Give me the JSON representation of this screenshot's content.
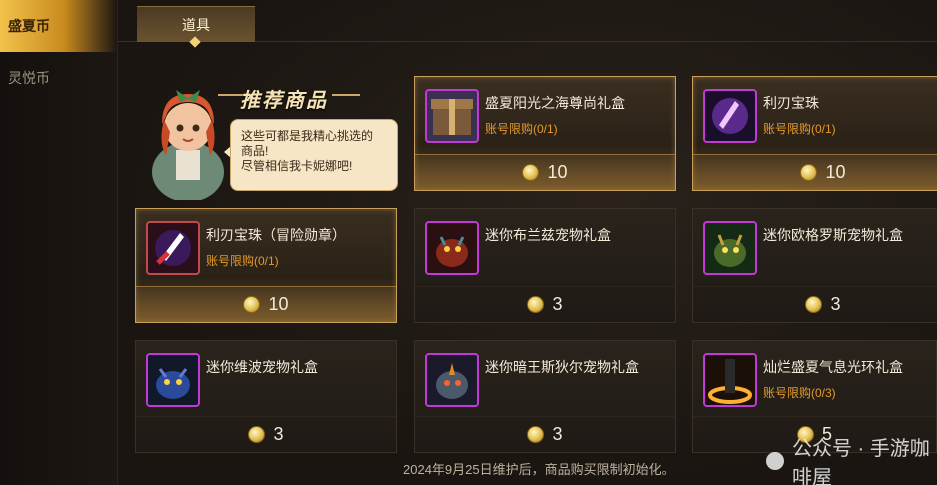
{
  "sidebar": {
    "items": [
      {
        "label": "盛夏币",
        "active": true
      },
      {
        "label": "灵悦币",
        "active": false
      }
    ]
  },
  "tabs": [
    {
      "label": "道具",
      "active": true
    }
  ],
  "recommend": {
    "title": "推荐商品",
    "speech_lines": [
      "这些可都是我精心挑选的",
      "商品!",
      "尽管相信我卡妮娜吧!"
    ]
  },
  "items": [
    {
      "name": "盛夏阳光之海尊尚礼盒",
      "limit": "账号限购(0/1)",
      "price": "10",
      "featured": true,
      "icon": "gift-box-icon"
    },
    {
      "name": "利刃宝珠",
      "limit": "账号限购(0/1)",
      "price": "10",
      "featured": true,
      "icon": "blade-orb-icon"
    },
    {
      "name": "利刃宝珠（冒险勋章）",
      "limit": "账号限购(0/1)",
      "price": "10",
      "featured": true,
      "icon": "blade-orb-medal-icon"
    },
    {
      "name": "迷你布兰兹宠物礼盒",
      "limit": "",
      "price": "3",
      "featured": false,
      "icon": "pet-red-dragon-icon"
    },
    {
      "name": "迷你欧格罗斯宠物礼盒",
      "limit": "",
      "price": "3",
      "featured": false,
      "icon": "pet-green-dragon-icon"
    },
    {
      "name": "迷你维波宠物礼盒",
      "limit": "",
      "price": "3",
      "featured": false,
      "icon": "pet-blue-beast-icon"
    },
    {
      "name": "迷你暗王斯狄尔宠物礼盒",
      "limit": "",
      "price": "3",
      "featured": false,
      "icon": "pet-dark-king-icon"
    },
    {
      "name": "灿烂盛夏气息光环礼盒",
      "limit": "账号限购(0/3)",
      "price": "5",
      "featured": false,
      "icon": "aura-ring-icon"
    }
  ],
  "footer": {
    "note": "2024年9月25日维护后，商品购买限制初始化。"
  },
  "watermark": {
    "text": "公众号 · 手游咖啡屋"
  },
  "colors": {
    "accent": "#f2c24a",
    "limit": "#e39a2c",
    "rarity_border": "#c238d8"
  }
}
